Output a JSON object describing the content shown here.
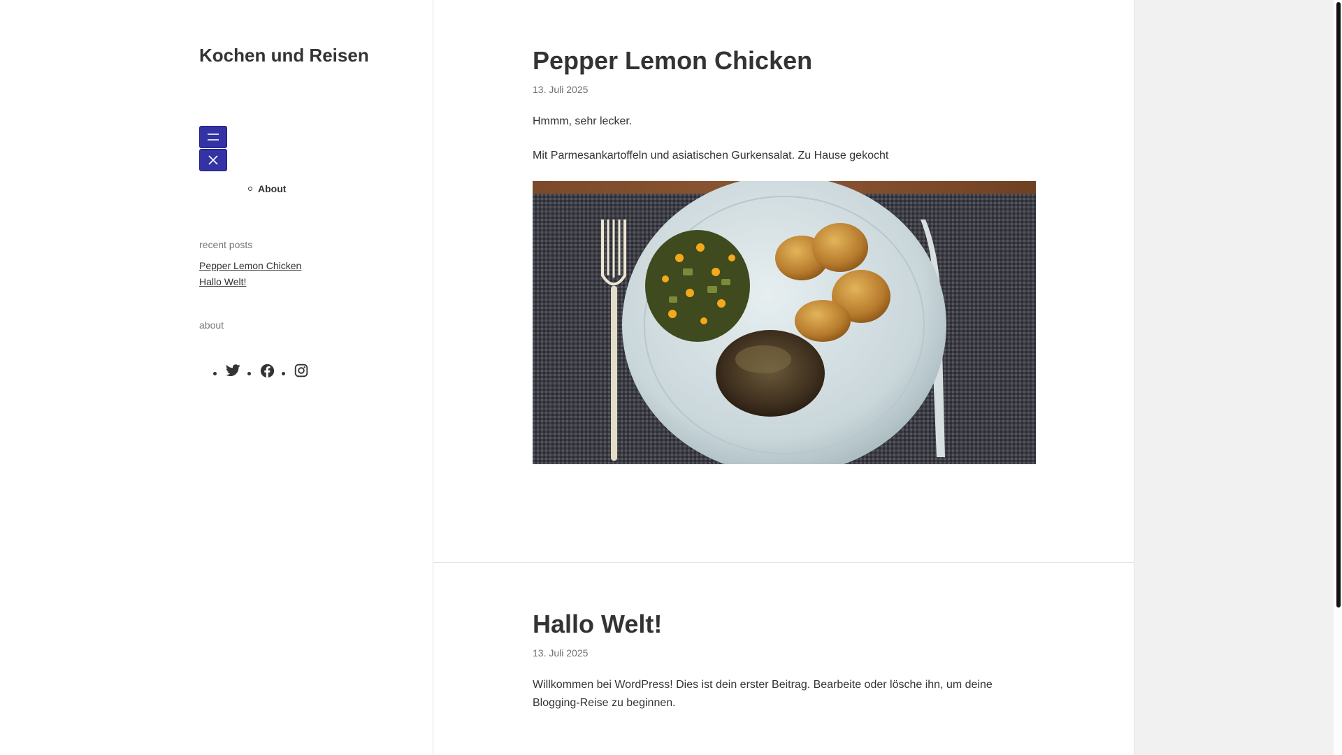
{
  "site": {
    "title": "Kochen und Reisen"
  },
  "nav": {
    "open_icon": "menu-icon",
    "close_icon": "close-icon",
    "items": [
      {
        "label": "About"
      }
    ]
  },
  "sidebar": {
    "recent_posts_title": "recent posts",
    "recent_posts": [
      {
        "label": "Pepper Lemon Chicken"
      },
      {
        "label": "Hallo Welt!"
      }
    ],
    "about_title": "about",
    "social": [
      {
        "icon": "twitter-icon"
      },
      {
        "icon": "facebook-icon"
      },
      {
        "icon": "instagram-icon"
      }
    ]
  },
  "posts": [
    {
      "title": "Pepper Lemon Chicken",
      "date": "13. Juli 2025",
      "paragraphs": [
        "Hmmm, sehr lecker.",
        "Mit Parmesankartoffeln und asiatischen Gurkensalat. Zu Hause gekocht"
      ],
      "image": "dinner-plate-photo"
    },
    {
      "title": "Hallo Welt!",
      "date": "13. Juli 2025",
      "paragraphs": [
        "Willkommen bei WordPress! Dies ist dein erster Beitrag. Bearbeite oder lösche ihn, um deine Blogging-Reise zu beginnen."
      ]
    }
  ],
  "colors": {
    "accent": "#3333a6",
    "text": "#333333",
    "muted": "#707070",
    "background": "#f1f1f1"
  }
}
